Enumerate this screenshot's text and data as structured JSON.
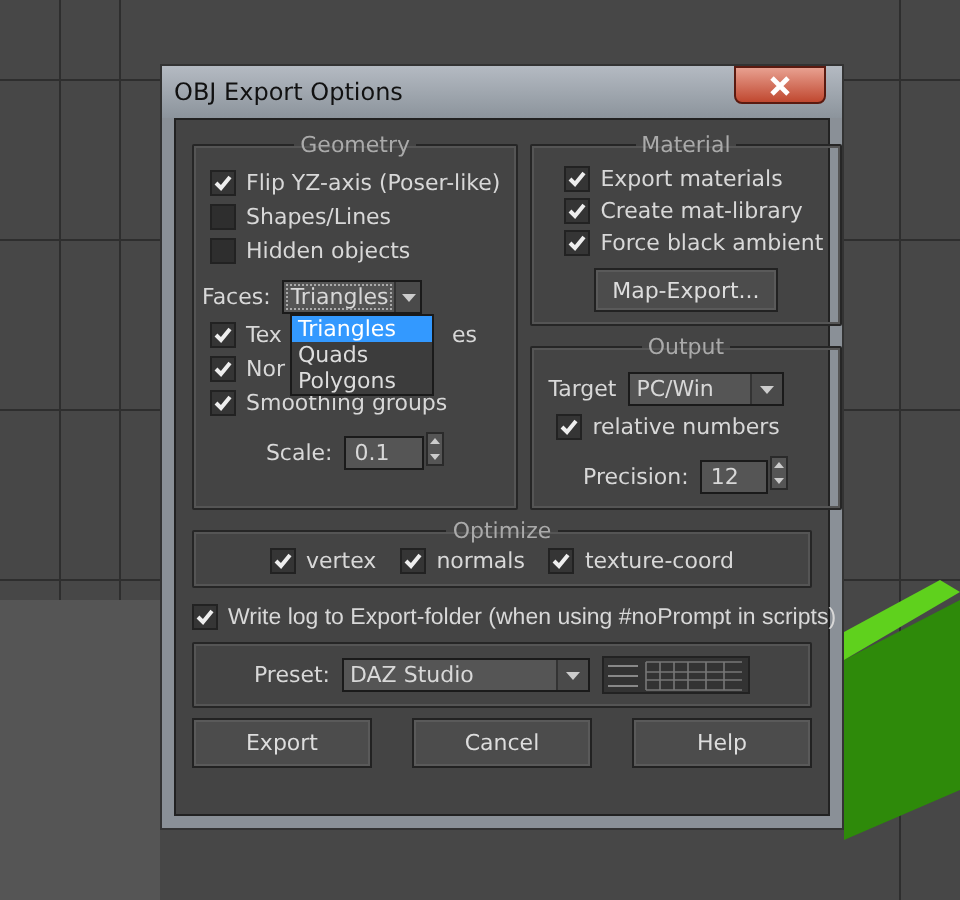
{
  "window": {
    "title": "OBJ Export Options"
  },
  "geometry": {
    "title": "Geometry",
    "options": [
      {
        "label": "Flip YZ-axis (Poser-like)",
        "checked": true
      },
      {
        "label": "Shapes/Lines",
        "checked": false
      },
      {
        "label": "Hidden objects",
        "checked": false
      }
    ],
    "faces": {
      "label": "Faces:",
      "value": "Triangles",
      "expanded": true,
      "options": [
        {
          "label": "Triangles",
          "selected": true
        },
        {
          "label": "Quads",
          "selected": false
        },
        {
          "label": "Polygons",
          "selected": false
        }
      ]
    },
    "options_after": [
      {
        "label": "Tex",
        "label_end": "es",
        "checked": true
      },
      {
        "label": "Nor",
        "checked": true
      },
      {
        "label": "Smoothing groups",
        "checked": true
      }
    ],
    "scale": {
      "label": "Scale:",
      "value": "0.1"
    }
  },
  "material": {
    "title": "Material",
    "options": [
      {
        "label": "Export materials",
        "checked": true
      },
      {
        "label": "Create mat-library",
        "checked": true
      },
      {
        "label": "Force black ambient",
        "checked": true
      }
    ],
    "button": "Map-Export..."
  },
  "output": {
    "title": "Output",
    "target": {
      "label": "Target",
      "value": "PC/Win"
    },
    "options": [
      {
        "label": "relative numbers",
        "checked": true
      }
    ],
    "precision": {
      "label": "Precision:",
      "value": "12"
    }
  },
  "optimize": {
    "title": "Optimize",
    "options": [
      {
        "label": "vertex",
        "checked": true
      },
      {
        "label": "normals",
        "checked": true
      },
      {
        "label": "texture-coord",
        "checked": true
      }
    ]
  },
  "write_log": {
    "label": "Write log to Export-folder (when using #noPrompt in scripts)",
    "checked": true
  },
  "preset": {
    "label": "Preset:",
    "value": "DAZ Studio"
  },
  "buttons": [
    "Export",
    "Cancel",
    "Help"
  ]
}
